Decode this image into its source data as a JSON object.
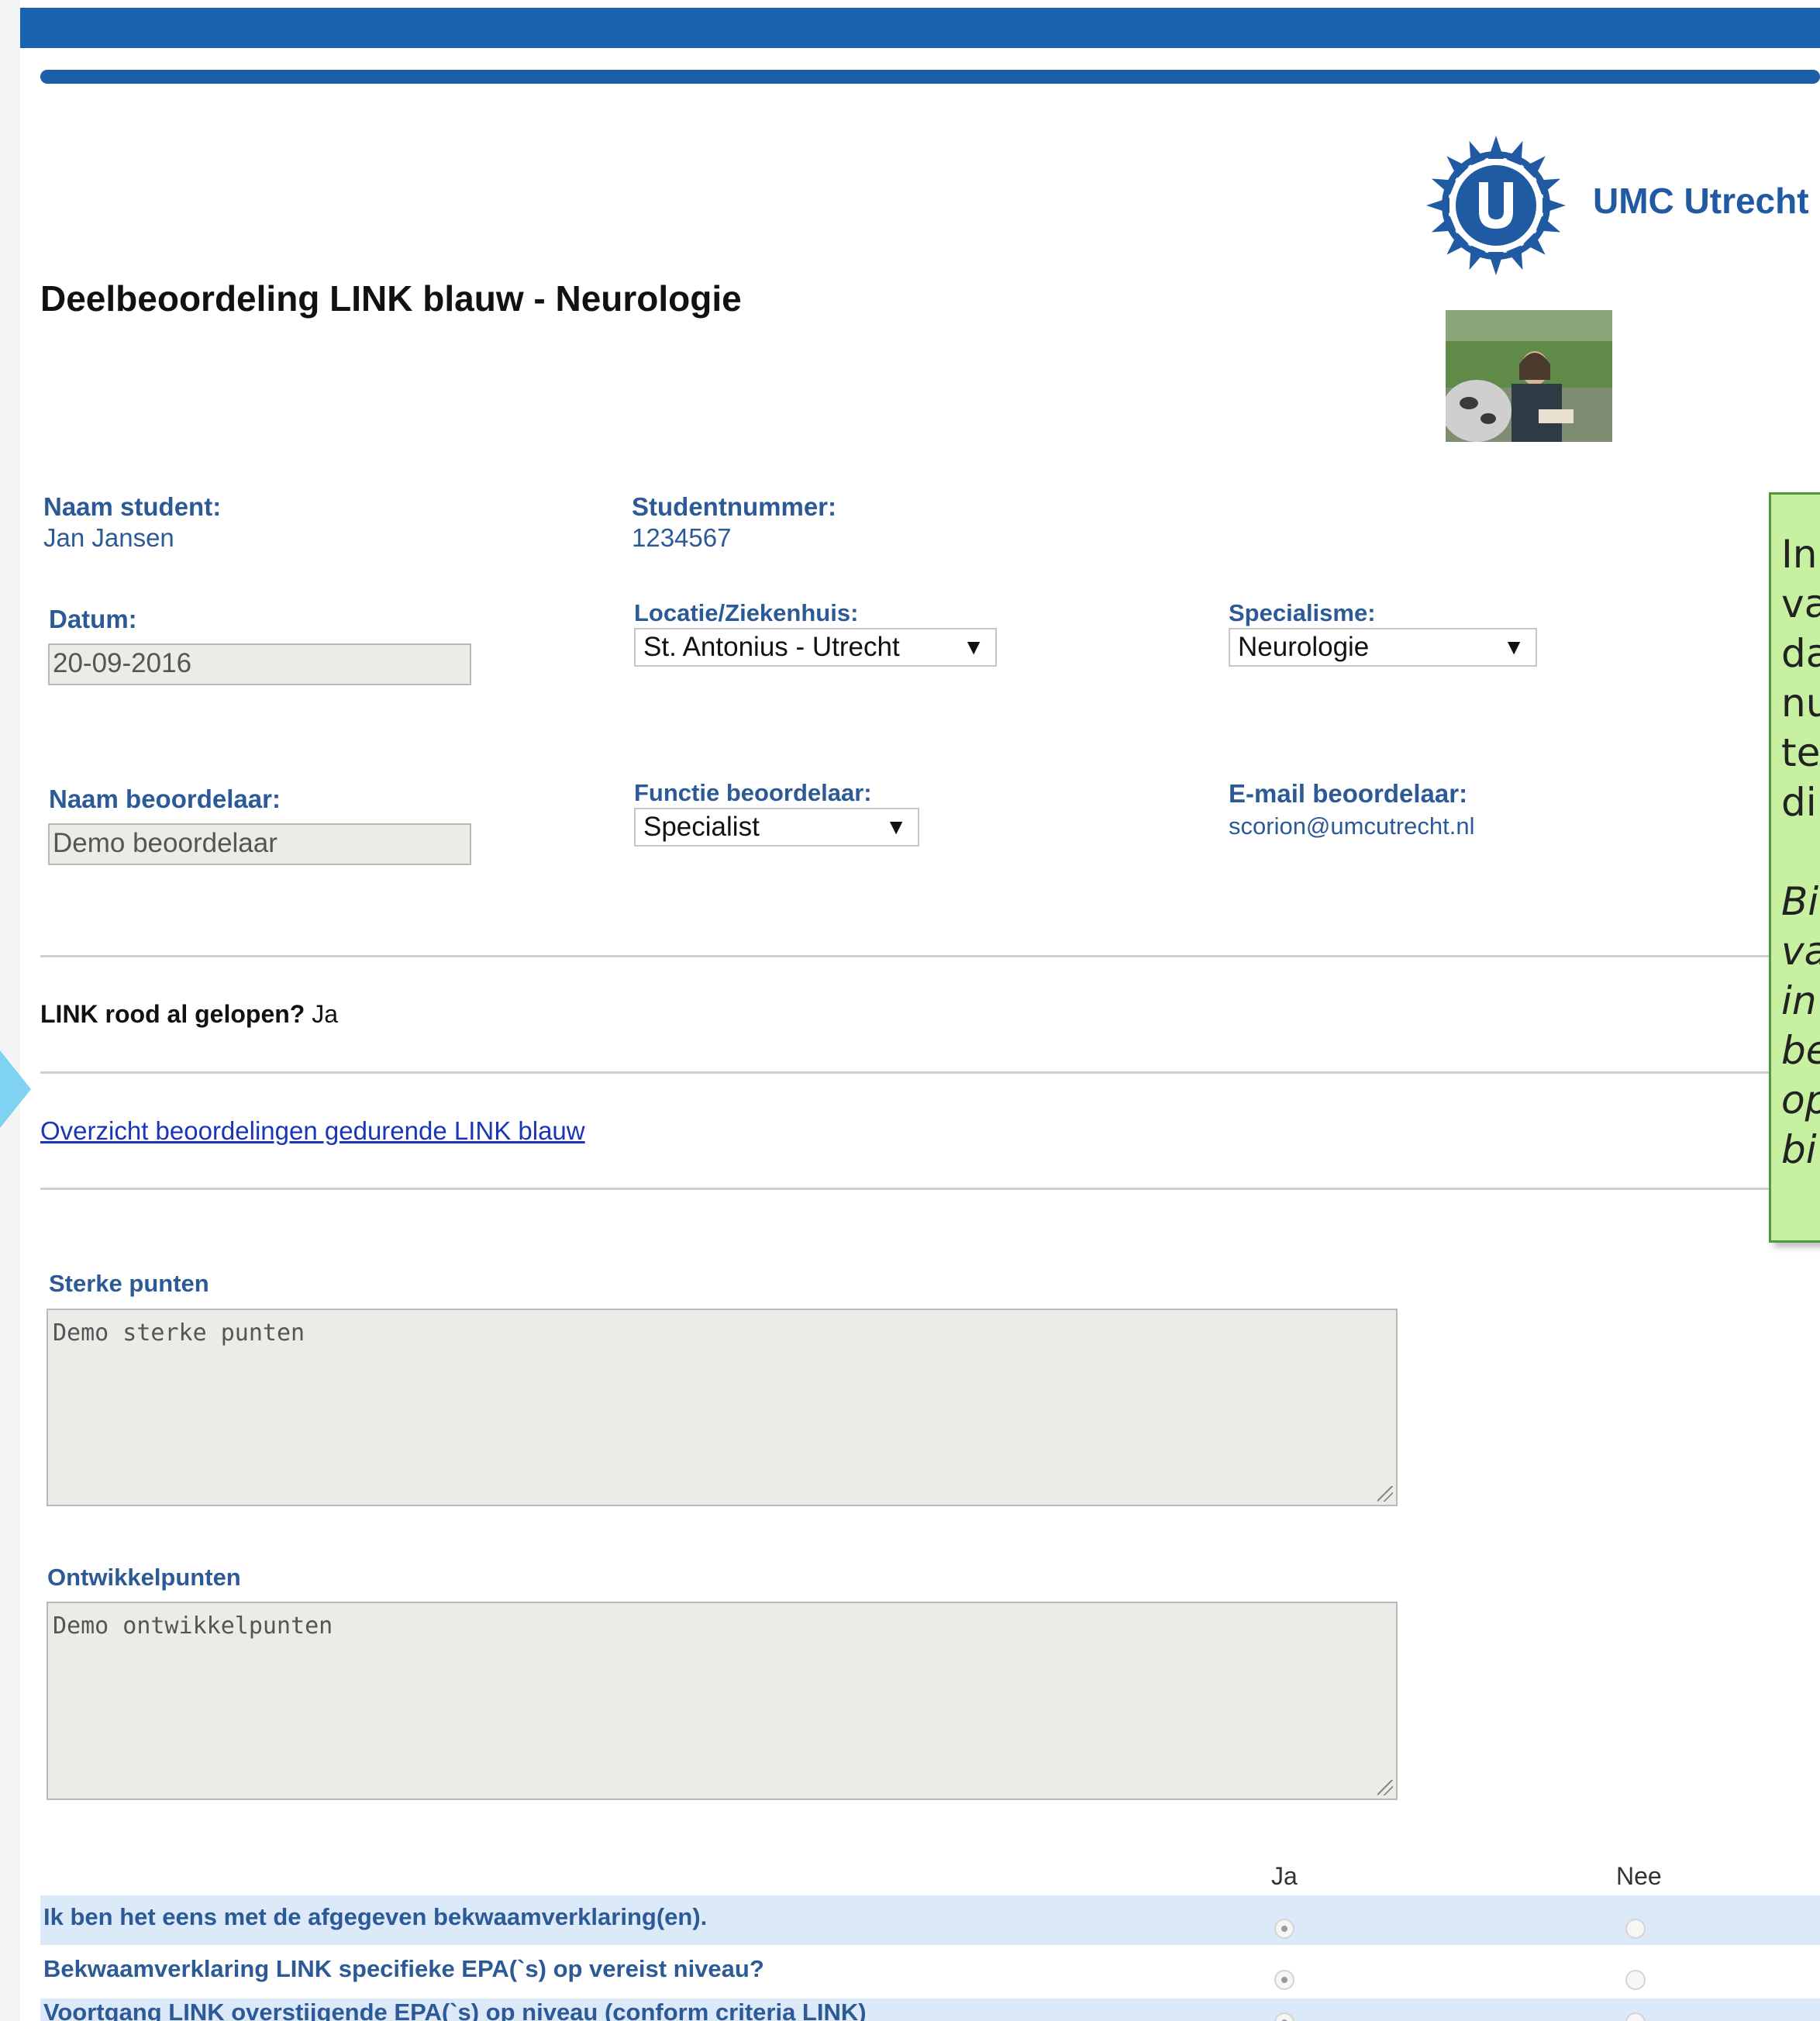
{
  "header": {
    "title": "Deelbeoordeling LINK blauw - Neurologie",
    "logo_text": "UMC Utrecht"
  },
  "student": {
    "name_label": "Naam student:",
    "name_value": "Jan Jansen",
    "number_label": "Studentnummer:",
    "number_value": "1234567"
  },
  "form": {
    "date_label": "Datum:",
    "date_value": "20-09-2016",
    "location_label": "Locatie/Ziekenhuis:",
    "location_value": "St. Antonius - Utrecht",
    "specialism_label": "Specialisme:",
    "specialism_value": "Neurologie",
    "assessor_name_label": "Naam beoordelaar:",
    "assessor_name_value": "Demo beoordelaar",
    "assessor_function_label": "Functie beoordelaar:",
    "assessor_function_value": "Specialist",
    "assessor_email_label": "E-mail beoordelaar:",
    "assessor_email_value": "scorion@umcutrecht.nl"
  },
  "link_rood": {
    "question": "LINK rood al gelopen?",
    "answer": "Ja"
  },
  "overview_link": "Overzicht beoordelingen gedurende LINK blauw",
  "strengths": {
    "label": "Sterke punten",
    "value": "Demo sterke punten"
  },
  "development": {
    "label": "Ontwikkelpunten",
    "value": "Demo ontwikkelpunten"
  },
  "questions": {
    "col_yes": "Ja",
    "col_no": "Nee",
    "items": [
      {
        "text": "Ik ben het eens met de afgegeven bekwaamverklaring(en).",
        "answer": "Ja"
      },
      {
        "text": "Bekwaamverklaring LINK specifieke EPA(`s) op vereist niveau?",
        "answer": "Ja"
      },
      {
        "text": "Voortgang LINK overstijgende EPA(`s) op niveau (conform criteria LINK)",
        "answer": "Ja"
      }
    ]
  },
  "side_note": {
    "lines": [
      "In",
      "va",
      "da",
      "nu",
      "te",
      "di"
    ],
    "italic_lines": [
      "Bi",
      "va",
      "in",
      "be",
      "op",
      "bi"
    ]
  },
  "colors": {
    "brand_blue": "#1b63b0",
    "label_blue": "#2c5a97",
    "note_green": "#c7f0a0"
  }
}
